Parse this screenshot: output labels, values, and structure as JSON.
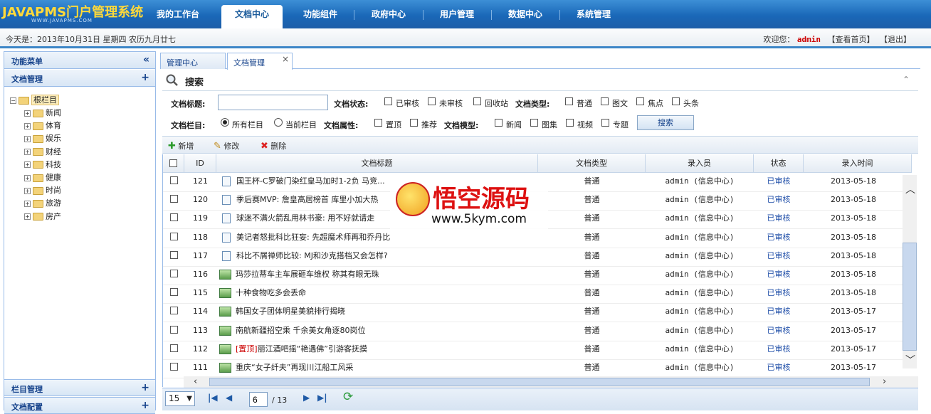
{
  "app": {
    "logo": "JAVAPMS门户管理系统",
    "logo_sub": "WWW.JAVAPMS.COM"
  },
  "nav": {
    "tabs": [
      "我的工作台",
      "文档中心",
      "功能组件",
      "政府中心",
      "用户管理",
      "数据中心",
      "系统管理"
    ],
    "active": "文档中心"
  },
  "datebar": {
    "date": "今天是：2013年10月31日 星期四 农历九月廿七",
    "welcome": "欢迎您：",
    "user": "admin",
    "home_link": "【查看首页】",
    "logout_link": "【退出】"
  },
  "left": {
    "menu_title": "功能菜单",
    "doc_mgmt": "文档管理",
    "tree_root": "根栏目",
    "tree_items": [
      "新闻",
      "体育",
      "娱乐",
      "财经",
      "科技",
      "健康",
      "时尚",
      "旅游",
      "房产"
    ],
    "column_mgmt": "栏目管理",
    "doc_config": "文档配置"
  },
  "tabs": {
    "items": [
      "管理中心",
      "文档管理"
    ]
  },
  "search": {
    "title": "搜索",
    "doc_title_label": "文档标题:",
    "doc_title_value": "",
    "doc_status_label": "文档状态:",
    "status_opts": [
      "已审核",
      "未审核",
      "回收站"
    ],
    "doc_type_label": "文档类型:",
    "type_opts": [
      "普通",
      "图文",
      "焦点",
      "头条"
    ],
    "column_label": "文档栏目:",
    "column_opts": [
      "所有栏目",
      "当前栏目"
    ],
    "attr_label": "文档属性:",
    "attr_opts": [
      "置顶",
      "推荐"
    ],
    "model_label": "文档模型:",
    "model_opts": [
      "新闻",
      "图集",
      "视频",
      "专题"
    ],
    "search_button": "搜索"
  },
  "toolbar": {
    "add": "新增",
    "edit": "修改",
    "delete": "删除"
  },
  "grid": {
    "headers": [
      "ID",
      "文档标题",
      "文档类型",
      "录入员",
      "状态",
      "录入时间"
    ],
    "rows": [
      {
        "id": "121",
        "icon": "doc",
        "prefix": "",
        "title": "国王杯-C罗破门染红皇马加时1-2负 马竞...",
        "type": "普通",
        "editor": "admin (信息中心)",
        "status": "已审核",
        "time": "2013-05-18"
      },
      {
        "id": "120",
        "icon": "doc",
        "prefix": "",
        "title": "季后赛MVP: 詹皇高居榜首 库里小加大热",
        "type": "普通",
        "editor": "admin (信息中心)",
        "status": "已审核",
        "time": "2013-05-18"
      },
      {
        "id": "119",
        "icon": "doc",
        "prefix": "",
        "title": "球迷不满火箭乱用林书豪: 用不好就请走",
        "type": "普通",
        "editor": "admin (信息中心)",
        "status": "已审核",
        "time": "2013-05-18"
      },
      {
        "id": "118",
        "icon": "doc",
        "prefix": "",
        "title": "美记者怒批科比狂妄: 先超魔术师再和乔丹比",
        "type": "普通",
        "editor": "admin (信息中心)",
        "status": "已审核",
        "time": "2013-05-18"
      },
      {
        "id": "117",
        "icon": "doc",
        "prefix": "",
        "title": "科比不屑禅师比较: MJ和沙克搭档又会怎样?",
        "type": "普通",
        "editor": "admin (信息中心)",
        "status": "已审核",
        "time": "2013-05-18"
      },
      {
        "id": "116",
        "icon": "img",
        "prefix": "",
        "title": "玛莎拉蒂车主车展砸车维权 称其有眼无珠",
        "type": "普通",
        "editor": "admin (信息中心)",
        "status": "已审核",
        "time": "2013-05-18"
      },
      {
        "id": "115",
        "icon": "img",
        "prefix": "",
        "title": "十种食物吃多会丢命",
        "type": "普通",
        "editor": "admin (信息中心)",
        "status": "已审核",
        "time": "2013-05-18"
      },
      {
        "id": "114",
        "icon": "img",
        "prefix": "",
        "title": "韩国女子团体明星美貌排行揭晓",
        "type": "普通",
        "editor": "admin (信息中心)",
        "status": "已审核",
        "time": "2013-05-17"
      },
      {
        "id": "113",
        "icon": "img",
        "prefix": "",
        "title": "南航新疆招空乘 千余美女角逐80岗位",
        "type": "普通",
        "editor": "admin (信息中心)",
        "status": "已审核",
        "time": "2013-05-17"
      },
      {
        "id": "112",
        "icon": "img",
        "prefix": "[置顶]",
        "title": "丽江酒吧摇“艳遇佛”引游客抚摸",
        "type": "普通",
        "editor": "admin (信息中心)",
        "status": "已审核",
        "time": "2013-05-17"
      },
      {
        "id": "111",
        "icon": "img",
        "prefix": "",
        "title": "重庆“女子纤夫”再现川江船工风采",
        "type": "普通",
        "editor": "admin (信息中心)",
        "status": "已审核",
        "time": "2013-05-17"
      }
    ]
  },
  "pager": {
    "page_size": "15",
    "current_page": "6",
    "total_pages": "/ 13"
  },
  "watermark": {
    "text": "悟空源码",
    "url": "www.5kym.com"
  }
}
